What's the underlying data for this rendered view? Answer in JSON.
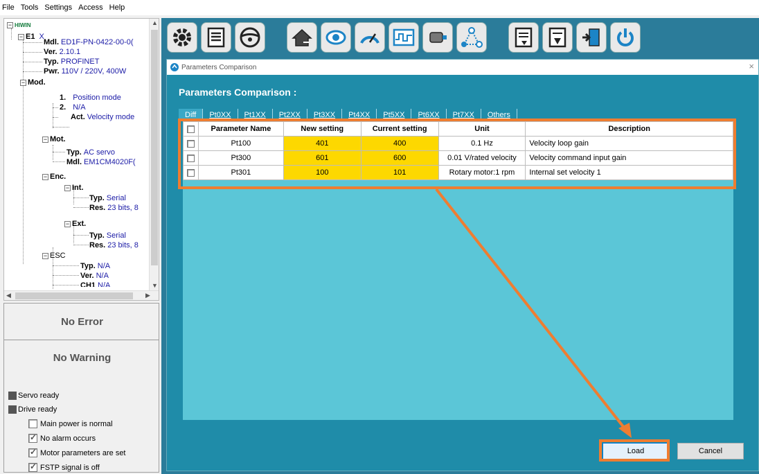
{
  "menu": [
    "File",
    "Tools",
    "Settings",
    "Access",
    "Help"
  ],
  "tree": {
    "root": "HIWIN",
    "node": "E1",
    "node_x": "X",
    "rows": [
      {
        "k": "Mdl.",
        "v": "ED1F-PN-0422-00-0("
      },
      {
        "k": "Ver.",
        "v": "2.10.1"
      },
      {
        "k": "Typ.",
        "v": "PROFINET"
      },
      {
        "k": "Pwr.",
        "v": "110V / 220V, 400W"
      }
    ],
    "mod": "Mod.",
    "mod_rows": [
      {
        "k": "1.",
        "v": "Position mode"
      },
      {
        "k": "2.",
        "v": "N/A"
      },
      {
        "k": "Act.",
        "v": "Velocity mode"
      }
    ],
    "mot": "Mot.",
    "mot_rows": [
      {
        "k": "Typ.",
        "v": "AC servo"
      },
      {
        "k": "Mdl.",
        "v": "EM1CM4020F("
      }
    ],
    "enc": "Enc.",
    "int": "Int.",
    "int_rows": [
      {
        "k": "Typ.",
        "v": "Serial"
      },
      {
        "k": "Res.",
        "v": "23 bits, 8"
      }
    ],
    "ext": "Ext.",
    "ext_rows": [
      {
        "k": "Typ.",
        "v": "Serial"
      },
      {
        "k": "Res.",
        "v": "23 bits, 8"
      }
    ],
    "esc": "ESC",
    "esc_rows": [
      {
        "k": "Typ.",
        "v": "N/A"
      },
      {
        "k": "Ver.",
        "v": "N/A"
      },
      {
        "k": "CH1",
        "v": "N/A"
      }
    ]
  },
  "status": {
    "error": "No Error",
    "warning": "No Warning",
    "servo_ready": "Servo ready",
    "drive_ready": "Drive ready",
    "checks": [
      {
        "label": "Main power is normal",
        "checked": false
      },
      {
        "label": "No alarm occurs",
        "checked": true
      },
      {
        "label": "Motor parameters are set",
        "checked": true
      },
      {
        "label": "FSTP signal is off",
        "checked": true
      }
    ]
  },
  "toolbar": [
    "settings-gear-icon",
    "document-edit-icon",
    "steering-wheel-icon",
    "home-icon",
    "eye-monitor-icon",
    "gauge-icon",
    "scope-waveform-icon",
    "motor-tuning-icon",
    "network-icon",
    "param-doc-icon",
    "param-export-icon",
    "chip-import-icon",
    "power-icon"
  ],
  "dialog": {
    "window_title": "Parameters Comparison",
    "close": "×",
    "heading": "Parameters Comparison :",
    "tabs": [
      "Diff",
      "Pt0XX",
      "Pt1XX",
      "Pt2XX",
      "Pt3XX",
      "Pt4XX",
      "Pt5XX",
      "Pt6XX",
      "Pt7XX",
      "Others"
    ],
    "columns": [
      "Parameter Name",
      "New setting",
      "Current setting",
      "Unit",
      "Description"
    ],
    "rows": [
      {
        "name": "Pt100",
        "new": "401",
        "current": "400",
        "unit": "0.1 Hz",
        "desc": "Velocity loop gain"
      },
      {
        "name": "Pt300",
        "new": "601",
        "current": "600",
        "unit": "0.01 V/rated velocity",
        "desc": "Velocity command input gain"
      },
      {
        "name": "Pt301",
        "new": "100",
        "current": "101",
        "unit": "Rotary motor:1 rpm",
        "desc": "Internal set velocity 1"
      }
    ],
    "load": "Load",
    "cancel": "Cancel"
  },
  "colors": {
    "accent": "#ee7d31",
    "highlight_cell": "#fdd800",
    "panel_bg": "#2b7c9a"
  }
}
